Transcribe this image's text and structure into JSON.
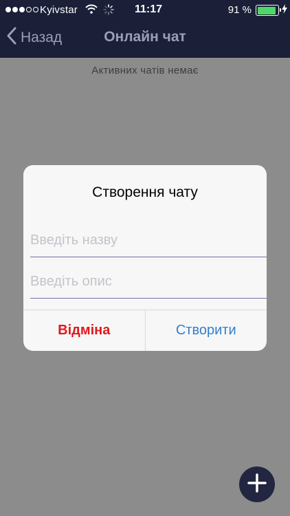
{
  "status_bar": {
    "carrier": "Kyivstar",
    "time": "11:17",
    "battery": "91 %",
    "battery_level": 0.91,
    "signal_bars_filled": 3,
    "signal_bars_total": 5
  },
  "nav": {
    "back_label": "Назад",
    "title": "Онлайн чат"
  },
  "main": {
    "empty_message": "Активних чатів немає"
  },
  "dialog": {
    "title": "Створення чату",
    "name_placeholder": "Введіть назву",
    "description_placeholder": "Введіть опис",
    "cancel_label": "Відміна",
    "create_label": "Створити"
  },
  "colors": {
    "header_bg": "#1b1f38",
    "overlay_bg": "#8c8c8c",
    "cancel": "#e0191c",
    "create": "#2f7fd0",
    "battery_fill": "#4cd964"
  },
  "icons": {
    "back": "chevron-left-icon",
    "wifi": "wifi-icon",
    "activity": "spinner-icon",
    "charging": "bolt-icon",
    "fab": "plus-icon"
  }
}
